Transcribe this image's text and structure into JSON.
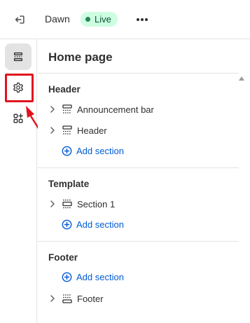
{
  "topbar": {
    "theme_name": "Dawn",
    "status_badge": "Live",
    "more_glyph": "•••"
  },
  "rail": {
    "items": [
      {
        "icon": "sections-icon",
        "active": true
      },
      {
        "icon": "theme-settings-gear-icon",
        "active": false,
        "highlighted": true
      },
      {
        "icon": "app-embeds-icon",
        "active": false
      }
    ]
  },
  "panel": {
    "title": "Home page",
    "groups": [
      {
        "title": "Header",
        "sections": [
          "Announcement bar",
          "Header"
        ],
        "add_label": "Add section"
      },
      {
        "title": "Template",
        "sections": [
          "Section 1"
        ],
        "add_label": "Add section"
      },
      {
        "title": "Footer",
        "add_label": "Add section",
        "sections": [
          "Footer"
        ]
      }
    ]
  },
  "colors": {
    "accent_link": "#005bd3",
    "live_badge_bg": "#cdfee1",
    "live_dot": "#29845a",
    "annotation_red": "#e0141e",
    "active_rail_bg": "#e3e3e3"
  }
}
